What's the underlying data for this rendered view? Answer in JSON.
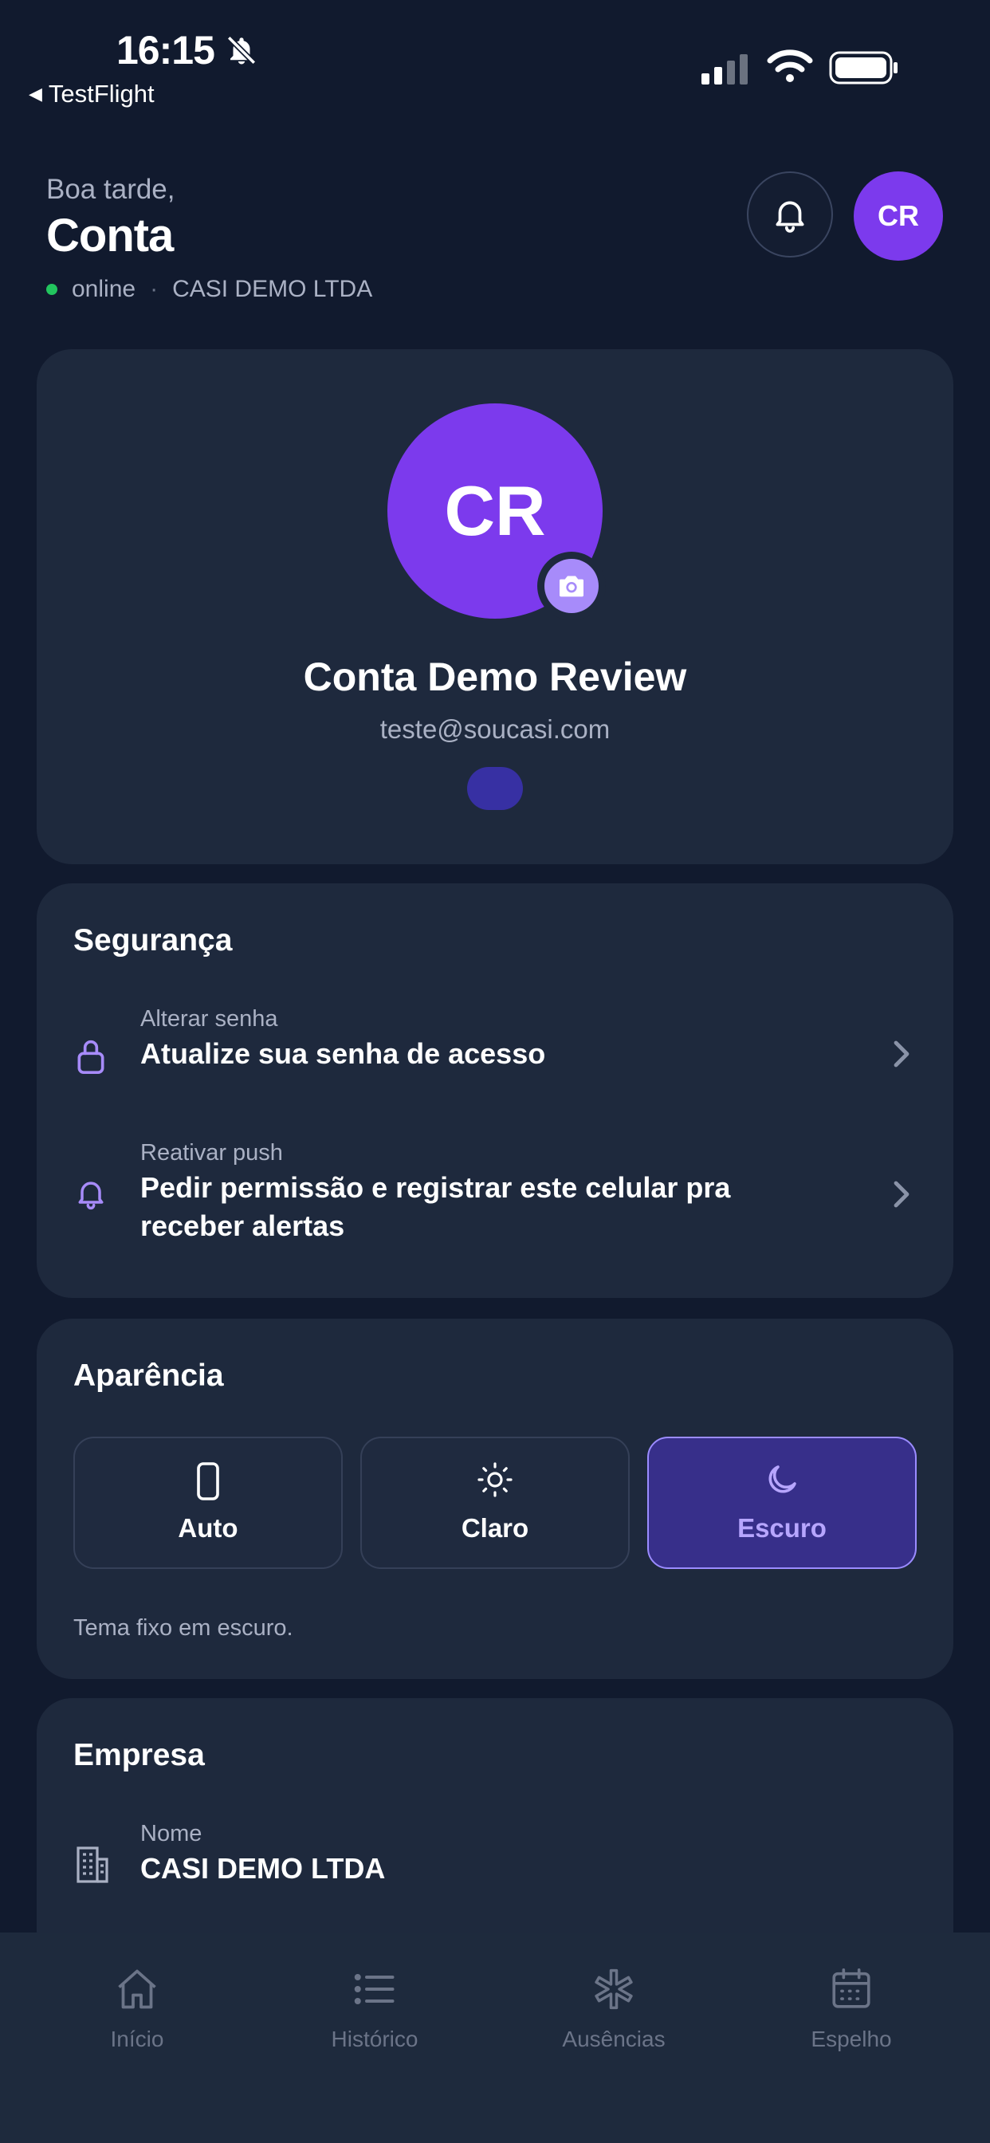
{
  "status_bar": {
    "time": "16:15",
    "back_label": "TestFlight"
  },
  "header": {
    "greeting": "Boa tarde,",
    "title": "Conta",
    "status": "online",
    "separator": "·",
    "company": "CASI DEMO LTDA",
    "avatar_initials": "CR"
  },
  "profile": {
    "initials": "CR",
    "name": "Conta Demo Review",
    "email": "teste@soucasi.com"
  },
  "security": {
    "title": "Segurança",
    "items": [
      {
        "label": "Alterar senha",
        "value": "Atualize sua senha de acesso",
        "icon": "lock-icon"
      },
      {
        "label": "Reativar push",
        "value": "Pedir permissão e registrar este celular pra receber alertas",
        "icon": "bell-icon"
      }
    ]
  },
  "appearance": {
    "title": "Aparência",
    "options": [
      {
        "label": "Auto",
        "icon": "phone-icon",
        "selected": false
      },
      {
        "label": "Claro",
        "icon": "sun-icon",
        "selected": false
      },
      {
        "label": "Escuro",
        "icon": "moon-icon",
        "selected": true
      }
    ],
    "note": "Tema fixo em escuro.",
    "accent": "#9b8cff"
  },
  "company": {
    "title": "Empresa",
    "name_label": "Nome",
    "name_value": "CASI DEMO LTDA"
  },
  "tabbar": {
    "tabs": [
      {
        "label": "Início",
        "icon": "home-icon"
      },
      {
        "label": "Histórico",
        "icon": "list-icon"
      },
      {
        "label": "Ausências",
        "icon": "asterisk-icon"
      },
      {
        "label": "Espelho",
        "icon": "calendar-icon"
      }
    ]
  }
}
